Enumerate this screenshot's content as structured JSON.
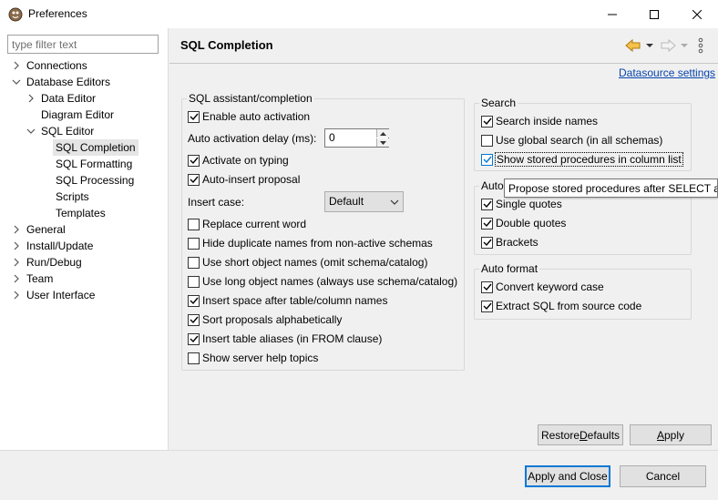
{
  "window": {
    "title": "Preferences"
  },
  "filter": {
    "placeholder": "type filter text",
    "value": ""
  },
  "tree": {
    "connections": "Connections",
    "database_editors": "Database Editors",
    "data_editor": "Data Editor",
    "diagram_editor": "Diagram Editor",
    "sql_editor": "SQL Editor",
    "sql_completion": "SQL Completion",
    "sql_formatting": "SQL Formatting",
    "sql_processing": "SQL Processing",
    "scripts": "Scripts",
    "templates": "Templates",
    "general": "General",
    "install_update": "Install/Update",
    "run_debug": "Run/Debug",
    "team": "Team",
    "user_interface": "User Interface"
  },
  "page": {
    "title": "SQL Completion",
    "datasource_link": "Datasource settings"
  },
  "assistant": {
    "title": "SQL assistant/completion",
    "enable_auto_activation": {
      "label": "Enable auto activation",
      "checked": true
    },
    "delay_label": "Auto activation delay (ms):",
    "delay_value": "0",
    "activate_on_typing": {
      "label": "Activate on typing",
      "checked": true
    },
    "auto_insert_proposal": {
      "label": "Auto-insert proposal",
      "checked": true
    },
    "insert_case_label": "Insert case:",
    "insert_case_value": "Default",
    "replace_current_word": {
      "label": "Replace current word",
      "checked": false
    },
    "hide_duplicate_names": {
      "label": "Hide duplicate names from non-active schemas",
      "checked": false
    },
    "short_object_names": {
      "label": "Use short object names (omit schema/catalog)",
      "checked": false
    },
    "long_object_names": {
      "label": "Use long object names (always use schema/catalog)",
      "checked": false
    },
    "insert_space": {
      "label": "Insert space after table/column names",
      "checked": true
    },
    "sort_alphabetically": {
      "label": "Sort proposals alphabetically",
      "checked": true
    },
    "insert_table_aliases": {
      "label": "Insert table aliases (in FROM clause)",
      "checked": true
    },
    "server_help_topics": {
      "label": "Show server help topics",
      "checked": false
    }
  },
  "search": {
    "title": "Search",
    "inside_names": {
      "label": "Search inside names",
      "checked": true
    },
    "global_search": {
      "label": "Use global search (in all schemas)",
      "checked": false
    },
    "stored_procedures": {
      "label": "Show stored procedures in column list",
      "checked": true
    }
  },
  "auto_close": {
    "title": "Auto",
    "single_quotes": {
      "label": "Single quotes",
      "checked": true
    },
    "double_quotes": {
      "label": "Double quotes",
      "checked": true
    },
    "brackets": {
      "label": "Brackets",
      "checked": true
    }
  },
  "auto_format": {
    "title": "Auto format",
    "convert_keyword_case": {
      "label": "Convert keyword case",
      "checked": true
    },
    "extract_sql": {
      "label": "Extract SQL from source code",
      "checked": true
    }
  },
  "tooltip": {
    "text": "Propose stored procedures after SELECT and"
  },
  "buttons": {
    "restore_defaults_pre": "Restore ",
    "restore_defaults_u": "D",
    "restore_defaults_post": "efaults",
    "apply_u": "A",
    "apply_post": "pply",
    "apply_and_close": "Apply and Close",
    "cancel": "Cancel"
  },
  "colors": {
    "accent": "#0078d7",
    "link": "#0645ad",
    "nav_back_arrow": "#e8a317"
  }
}
